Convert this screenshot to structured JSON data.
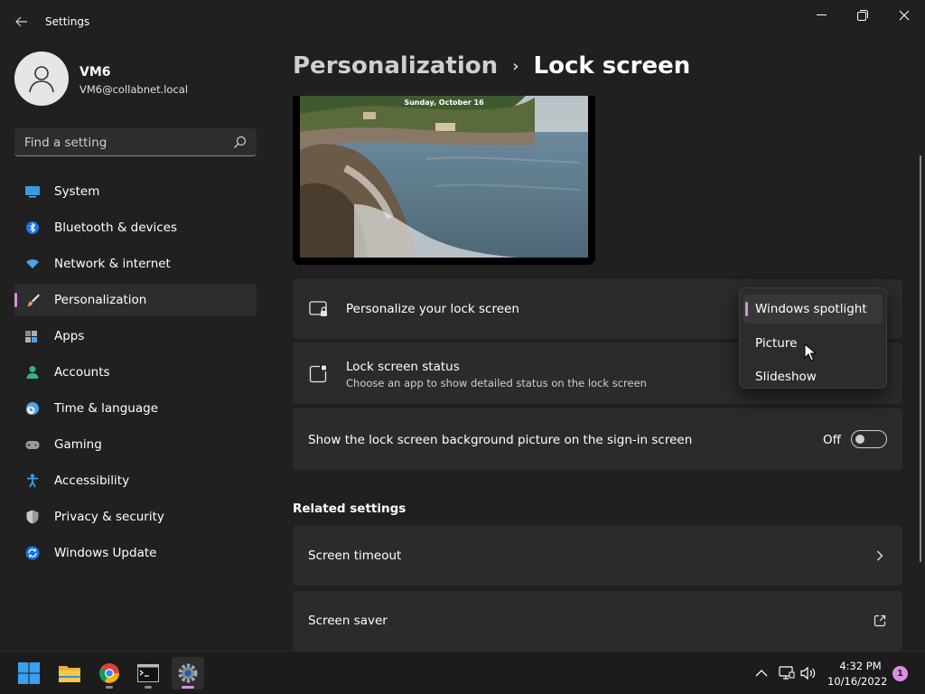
{
  "window": {
    "title": "Settings"
  },
  "user": {
    "name": "VM6",
    "email": "VM6@collabnet.local"
  },
  "search": {
    "placeholder": "Find a setting"
  },
  "sidebar": {
    "items": [
      {
        "label": "System",
        "icon": "monitor-icon"
      },
      {
        "label": "Bluetooth & devices",
        "icon": "bluetooth-icon"
      },
      {
        "label": "Network & internet",
        "icon": "wifi-icon"
      },
      {
        "label": "Personalization",
        "icon": "paintbrush-icon",
        "active": true
      },
      {
        "label": "Apps",
        "icon": "apps-icon"
      },
      {
        "label": "Accounts",
        "icon": "person-icon"
      },
      {
        "label": "Time & language",
        "icon": "clock-globe-icon"
      },
      {
        "label": "Gaming",
        "icon": "gamepad-icon"
      },
      {
        "label": "Accessibility",
        "icon": "accessibility-icon"
      },
      {
        "label": "Privacy & security",
        "icon": "shield-icon"
      },
      {
        "label": "Windows Update",
        "icon": "update-icon"
      }
    ]
  },
  "breadcrumb": {
    "parent": "Personalization",
    "separator": "›",
    "current": "Lock screen"
  },
  "preview": {
    "date": "Sunday, October 16"
  },
  "settings": {
    "personalize": {
      "title": "Personalize your lock screen"
    },
    "status": {
      "title": "Lock screen status",
      "subtitle": "Choose an app to show detailed status on the lock screen"
    },
    "signin": {
      "title": "Show the lock screen background picture on the sign-in screen",
      "state": "Off"
    }
  },
  "dropdown": {
    "options": [
      "Windows spotlight",
      "Picture",
      "Slideshow"
    ],
    "selected": "Windows spotlight"
  },
  "related": {
    "heading": "Related settings",
    "items": [
      {
        "label": "Screen timeout",
        "icon": "chevron-right-icon"
      },
      {
        "label": "Screen saver",
        "icon": "external-link-icon"
      }
    ]
  },
  "taskbar": {
    "apps": [
      "start-icon",
      "file-explorer-icon",
      "chrome-icon",
      "terminal-icon",
      "settings-icon"
    ],
    "time": "4:32 PM",
    "date": "10/16/2022",
    "notifications": "1"
  },
  "colors": {
    "accent": "#d98ee0",
    "background": "#202020",
    "card": "#2b2b2b"
  }
}
